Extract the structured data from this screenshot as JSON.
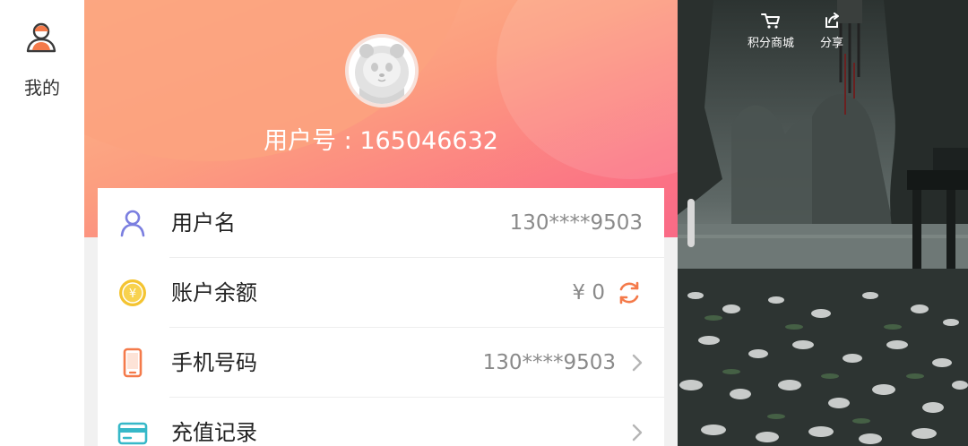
{
  "rail": {
    "tab_label": "我的"
  },
  "profile": {
    "user_id_text": "用户号 : 165046632"
  },
  "rows": [
    {
      "icon": "user-icon",
      "label": "用户名",
      "value": "130****9503"
    },
    {
      "icon": "coin-icon",
      "label": "账户余额",
      "value": "¥ 0"
    },
    {
      "icon": "phone-icon",
      "label": "手机号码",
      "value": "130****9503"
    },
    {
      "icon": "card-icon",
      "label": "充值记录",
      "value": ""
    }
  ],
  "scene": {
    "points_mall_label": "积分商城",
    "share_label": "分享"
  },
  "colors": {
    "accent_orange": "#f47a4a",
    "user_icon": "#7b7fe0",
    "coin": "#f4c431",
    "phone": "#f47a4a",
    "card": "#36b8c8"
  }
}
